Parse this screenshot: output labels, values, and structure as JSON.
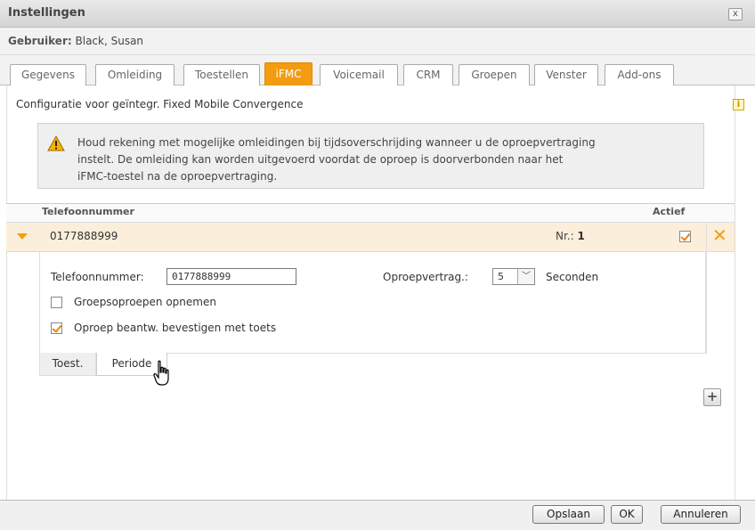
{
  "window": {
    "title": "Instellingen",
    "close_label": "x"
  },
  "user": {
    "label": "Gebruiker:",
    "name": "Black, Susan"
  },
  "tabs": [
    {
      "label": "Gegevens"
    },
    {
      "label": "Omleiding"
    },
    {
      "label": "Toestellen"
    },
    {
      "label": "iFMC"
    },
    {
      "label": "Voicemail"
    },
    {
      "label": "CRM"
    },
    {
      "label": "Groepen"
    },
    {
      "label": "Venster"
    },
    {
      "label": "Add-ons"
    }
  ],
  "active_tab": "iFMC",
  "content": {
    "description": "Configuratie voor geïntegr. Fixed Mobile Convergence",
    "info_icon": "i",
    "warning_lines": [
      "Houd rekening met mogelijke omleidingen bij tijdsoverschrijding wanneer u de oproepvertraging",
      "instelt. De omleiding kan worden uitgevoerd voordat de oproep is doorverbonden naar het",
      "iFMC-toestel na de oproepvertraging."
    ]
  },
  "table": {
    "col_phone": "Telefoonnummer",
    "col_active": "Actief",
    "rows": [
      {
        "number": "0177888999",
        "nr_label": "Nr.:",
        "nr_value": "1",
        "active": true
      }
    ]
  },
  "detail": {
    "phone_label": "Telefoonnummer:",
    "phone_value": "0177888999",
    "delay_label": "Oproepvertrag.:",
    "delay_value": "5",
    "delay_unit": "Seconden",
    "group_calls_label": "Groepsoproepen opnemen",
    "group_calls_checked": false,
    "confirm_label": "Oproep beantw. bevestigen met toets",
    "confirm_checked": true,
    "subtabs": [
      {
        "label": "Toest."
      },
      {
        "label": "Periode"
      }
    ],
    "active_subtab": "Periode"
  },
  "add_button": "+",
  "footer": {
    "save": "Opslaan",
    "ok": "OK",
    "cancel": "Annuleren"
  },
  "colors": {
    "accent": "#f39c12",
    "row_highlight": "#fbeedb"
  }
}
